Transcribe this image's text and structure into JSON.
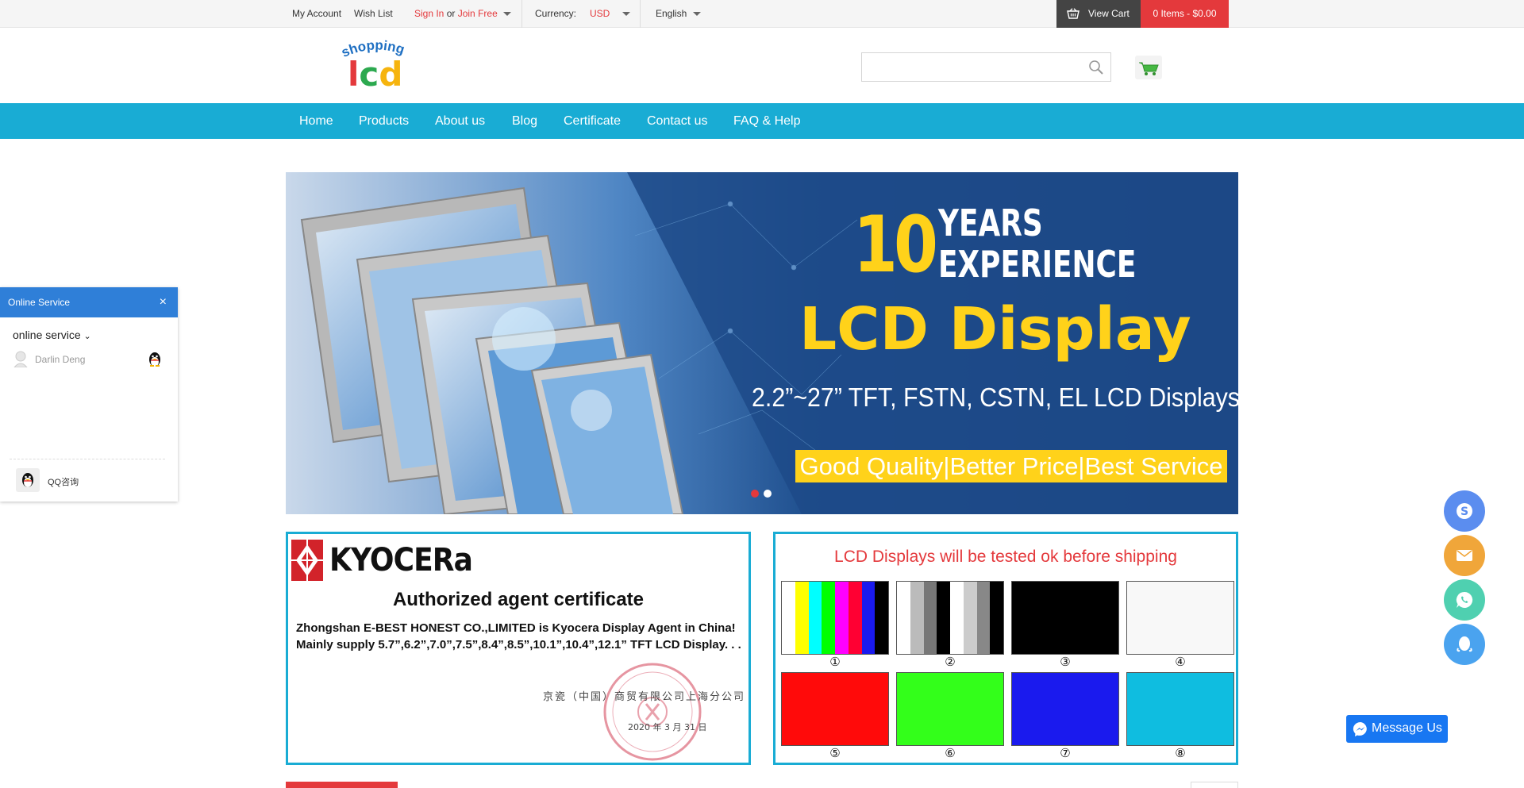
{
  "topbar": {
    "my_account": "My Account",
    "wish_list": "Wish List",
    "sign_in": "Sign In",
    "or": "or",
    "join_free": "Join Free",
    "currency_label": "Currency:",
    "currency_value": "USD",
    "language": "English",
    "view_cart": "View Cart",
    "cart_items": "0 Items - $0.00"
  },
  "header": {
    "logo_text_top": "shopping",
    "logo_text_main": "lcd",
    "search_placeholder": ""
  },
  "nav": {
    "items": [
      {
        "label": "Home"
      },
      {
        "label": "Products"
      },
      {
        "label": "About us"
      },
      {
        "label": "Blog"
      },
      {
        "label": "Certificate"
      },
      {
        "label": "Contact us"
      },
      {
        "label": "FAQ & Help"
      }
    ]
  },
  "banner": {
    "years_number": "10",
    "years_line1": "YEARS",
    "years_line2": "EXPERIENCE",
    "headline": "LCD Display",
    "sizes": "2.2”~27” TFT, FSTN, CSTN, EL LCD Displays",
    "tagline": "Good Quality|Better Price|Best Service",
    "slides_total": 2,
    "active_slide": 1
  },
  "certificate": {
    "brand": "KYOCERa",
    "title": "Authorized agent certificate",
    "line1": "Zhongshan E-BEST HONEST CO.,LIMITED is Kyocera Display Agent in China!",
    "line2": "Mainly supply 5.7”,6.2”,7.0”,7.5”,8.4”,8.5”,10.1”,10.4”,12.1” TFT LCD Display. . .",
    "issuer_cn": "京瓷（中国）商贸有限公司上海分公司",
    "date_cn": "2020 年 3 月 31 日"
  },
  "test_panel": {
    "title": "LCD Displays will be tested ok before shipping",
    "swatches": [
      {
        "label": "①",
        "kind": "colorbars"
      },
      {
        "label": "②",
        "kind": "graybars"
      },
      {
        "label": "③",
        "color": "#000000"
      },
      {
        "label": "④",
        "color": "#f8f8f8"
      },
      {
        "label": "⑤",
        "color": "#ff0a0a"
      },
      {
        "label": "⑥",
        "color": "#33ff1a"
      },
      {
        "label": "⑦",
        "color": "#1a1aee"
      },
      {
        "label": "⑧",
        "color": "#0fbde0"
      }
    ]
  },
  "online_service": {
    "title": "Online Service",
    "close": "×",
    "group": "online service",
    "agent": "Darlin Deng",
    "qq_label": "QQ咨询"
  },
  "floating": {
    "message_us": "Message Us"
  },
  "colors": {
    "accent": "#19acd4",
    "red": "#e4393c",
    "service_blue": "#2f7fd8",
    "skype": "#5b8def",
    "mail": "#f0a63a",
    "whatsapp": "#4fd0b0",
    "qq": "#4aa3ef"
  }
}
